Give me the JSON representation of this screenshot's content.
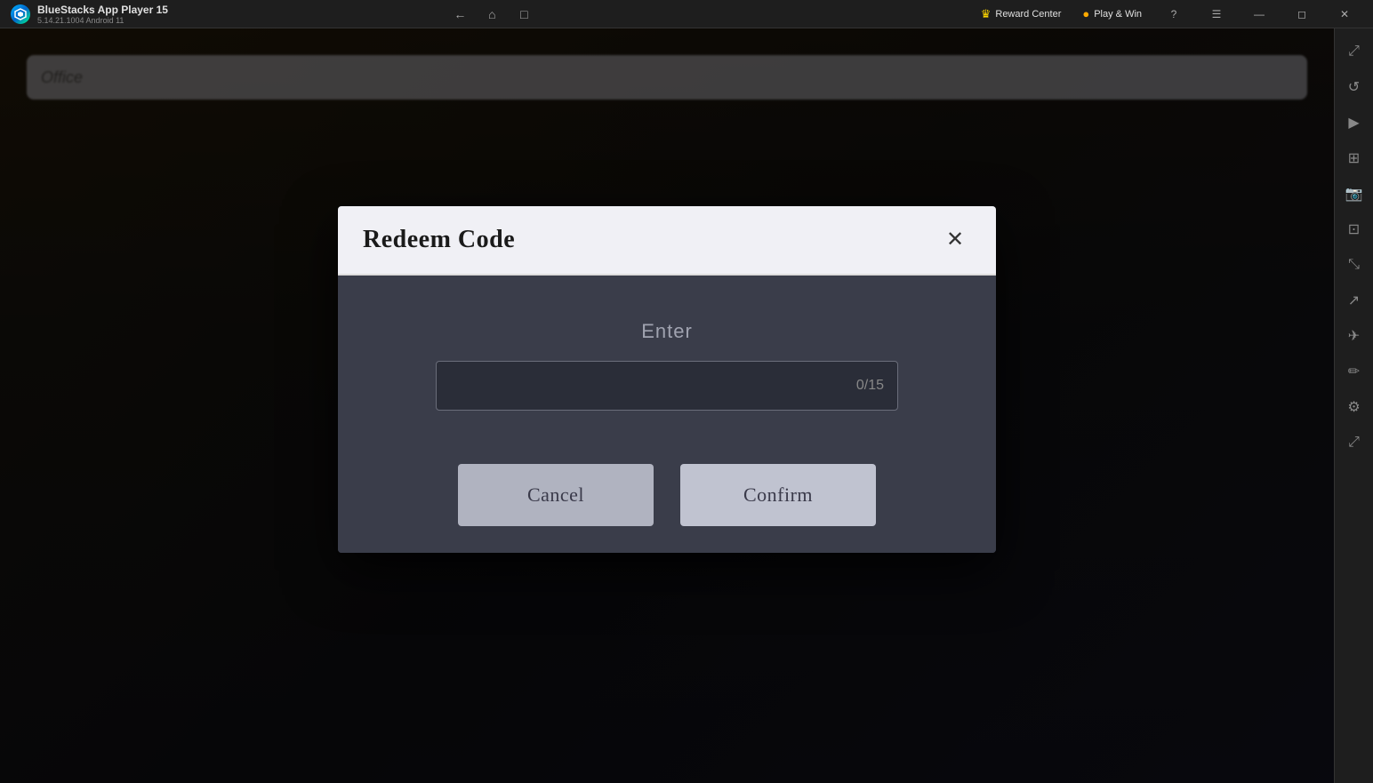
{
  "titlebar": {
    "app_name": "BlueStacks App Player 15",
    "version": "5.14.21.1004  Android 11",
    "reward_center_label": "Reward Center",
    "play_win_label": "Play & Win",
    "nav_icons": [
      "back",
      "home",
      "copy"
    ],
    "window_controls": [
      "minimize",
      "restore",
      "close"
    ]
  },
  "sidebar": {
    "icons": [
      "expand",
      "refresh",
      "play-circle",
      "grid",
      "camera",
      "screenshot",
      "fit-screen",
      "send",
      "airplane",
      "eraser",
      "settings",
      "expand-arrows"
    ]
  },
  "modal": {
    "title": "Redeem Code",
    "enter_label": "Enter",
    "close_label": "×",
    "char_count": "0/15",
    "input_placeholder": "",
    "cancel_label": "Cancel",
    "confirm_label": "Confirm"
  },
  "game_bg": {
    "blurred_topbar_text": "Office"
  }
}
